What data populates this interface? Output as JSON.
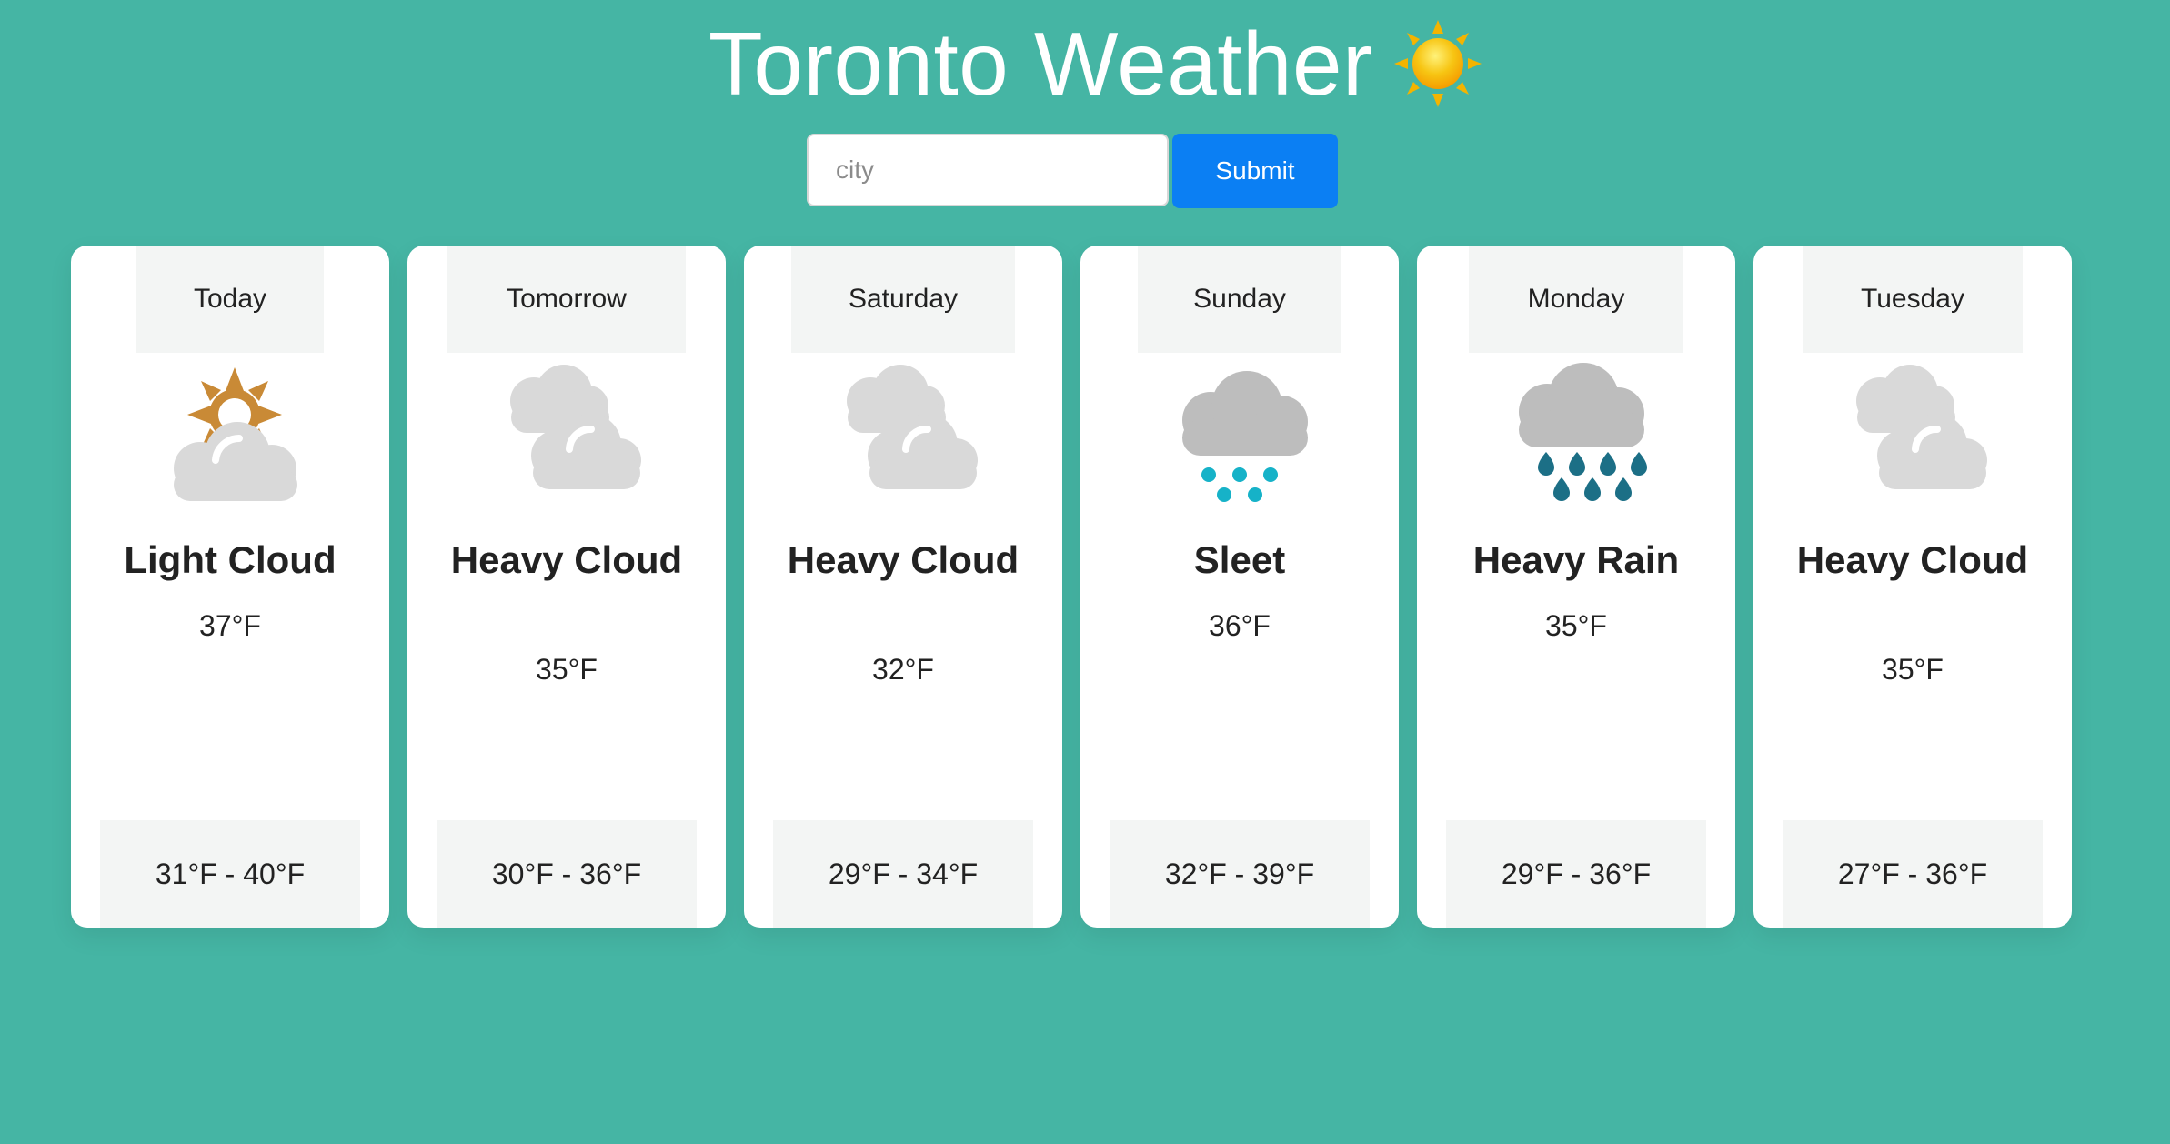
{
  "header": {
    "title": "Toronto Weather",
    "emoji_icon": "sun-icon"
  },
  "search": {
    "placeholder": "city",
    "value": "",
    "submit_label": "Submit"
  },
  "forecast": [
    {
      "day": "Today",
      "condition": "Light Cloud",
      "temperature": "37°F",
      "range": "31°F - 40°F",
      "icon": "light-cloud-icon"
    },
    {
      "day": "Tomorrow",
      "condition": "Heavy Cloud",
      "temperature": "35°F",
      "range": "30°F - 36°F",
      "icon": "heavy-cloud-icon"
    },
    {
      "day": "Saturday",
      "condition": "Heavy Cloud",
      "temperature": "32°F",
      "range": "29°F - 34°F",
      "icon": "heavy-cloud-icon"
    },
    {
      "day": "Sunday",
      "condition": "Sleet",
      "temperature": "36°F",
      "range": "32°F - 39°F",
      "icon": "sleet-icon"
    },
    {
      "day": "Monday",
      "condition": "Heavy Rain",
      "temperature": "35°F",
      "range": "29°F - 36°F",
      "icon": "heavy-rain-icon"
    },
    {
      "day": "Tuesday",
      "condition": "Heavy Cloud",
      "temperature": "35°F",
      "range": "27°F - 36°F",
      "icon": "heavy-cloud-icon"
    }
  ],
  "colors": {
    "background": "#45b5a4",
    "card": "#ffffff",
    "panel": "#f3f5f4",
    "button": "#0b7ff3",
    "sun_orange": "#c98a36",
    "cloud_gray": "#d9d9d9",
    "dark_cloud_gray": "#bdbdbd",
    "sleet_blue": "#16b2c8",
    "rain_blue": "#1c6f86"
  }
}
